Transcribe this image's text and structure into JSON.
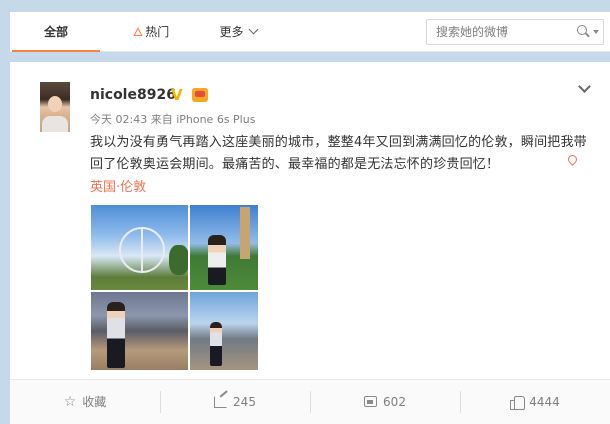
{
  "tabs": {
    "all": "全部",
    "hot": "热门",
    "more": "更多"
  },
  "search": {
    "placeholder": "搜索她的微博"
  },
  "post": {
    "username": "nicole8926",
    "verified_badge": "V",
    "meta": "今天 02:43 来自 iPhone 6s Plus",
    "text": "我以为没有勇气再踏入这座美丽的城市，整整4年又回到满满回忆的伦敦，瞬间把我带回了伦敦奥运会期间。最痛苦的、最幸福的都是无法忘怀的珍贵回忆！",
    "location": "英国·伦敦",
    "photo_count": 4
  },
  "actions": {
    "favorite": "收藏",
    "repost": "245",
    "comment": "602",
    "like": "4444"
  },
  "colors": {
    "accent": "#ff8140",
    "location": "#eb7350",
    "verified": "#f7b500",
    "background": "#c5d9ea"
  },
  "icons": [
    "flame-icon",
    "chevron-down-icon",
    "search-icon",
    "verified-icon",
    "vip-crown-icon",
    "location-pin-icon",
    "star-icon",
    "share-icon",
    "comment-icon",
    "like-icon"
  ]
}
